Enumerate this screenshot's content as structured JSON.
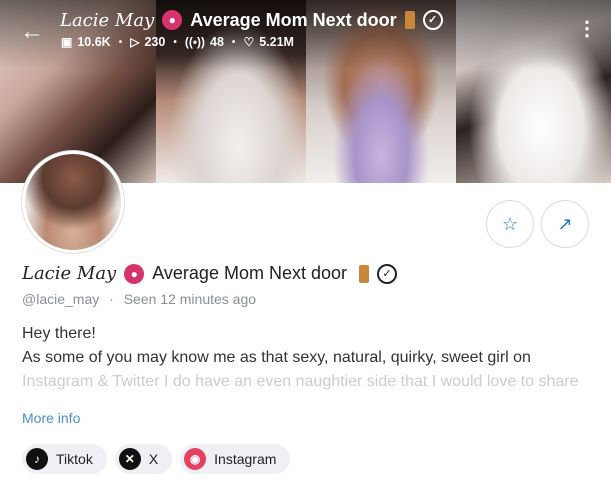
{
  "header": {
    "back_icon": "arrow-left-icon",
    "name_script": "Lacie May",
    "name_text": "Average Mom Next door",
    "stats": {
      "photos": "10.6K",
      "videos": "230",
      "streams": "48",
      "likes": "5.21M"
    },
    "more_icon": "more-vertical-icon"
  },
  "profile": {
    "name_script": "Lacie May",
    "name_text": "Average Mom Next door",
    "handle": "@lacie_may",
    "seen_label": "Seen",
    "seen_time": "12 minutes ago",
    "bio_line1": "Hey there!",
    "bio_line2": "As some of you may know me as that sexy, natural, quirky, sweet girl on",
    "bio_line3": "Instagram & Twitter I do have an even naughtier side that I would love to share",
    "more_info": "More info"
  },
  "actions": {
    "favorite_icon": "star-icon",
    "share_icon": "share-icon"
  },
  "socials": [
    {
      "label": "Tiktok",
      "icon": "tiktok-icon"
    },
    {
      "label": "X",
      "icon": "x-icon"
    },
    {
      "label": "Instagram",
      "icon": "instagram-icon"
    }
  ],
  "colors": {
    "accent": "#1e7ec1",
    "link": "#4a90c2",
    "kiss": "#d6336c"
  }
}
